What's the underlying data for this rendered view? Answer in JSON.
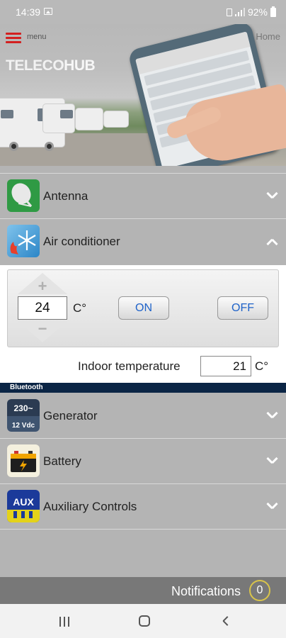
{
  "status_bar": {
    "time": "14:39",
    "battery": "92%"
  },
  "header": {
    "menu_label": "menu",
    "home_label": "Home",
    "logo_left": "TELECO",
    "logo_right": "HUB"
  },
  "sections": [
    {
      "id": "antenna",
      "label": "Antenna",
      "expanded": false
    },
    {
      "id": "air_conditioner",
      "label": "Air conditioner",
      "expanded": true
    },
    {
      "id": "generator",
      "label": "Generator",
      "expanded": false,
      "icon_text_top": "230~",
      "icon_text_bottom": "12 Vdc"
    },
    {
      "id": "battery",
      "label": "Battery",
      "expanded": false
    },
    {
      "id": "auxiliary",
      "label": "Auxiliary Controls",
      "expanded": false,
      "icon_text": "AUX"
    }
  ],
  "air_conditioner": {
    "increase_symbol": "+",
    "decrease_symbol": "−",
    "setpoint": "24",
    "unit": "C°",
    "on_label": "ON",
    "off_label": "OFF",
    "indoor_label": "Indoor temperature",
    "indoor_value": "21",
    "indoor_unit": "C°"
  },
  "bluetooth_label": "Bluetooth",
  "notifications": {
    "label": "Notifications",
    "count": "0"
  },
  "colors": {
    "menu_icon": "#d32020",
    "button_text": "#1f63c9",
    "bluetooth_strip": "#0b2545",
    "notification_ring": "#d9c44a"
  }
}
